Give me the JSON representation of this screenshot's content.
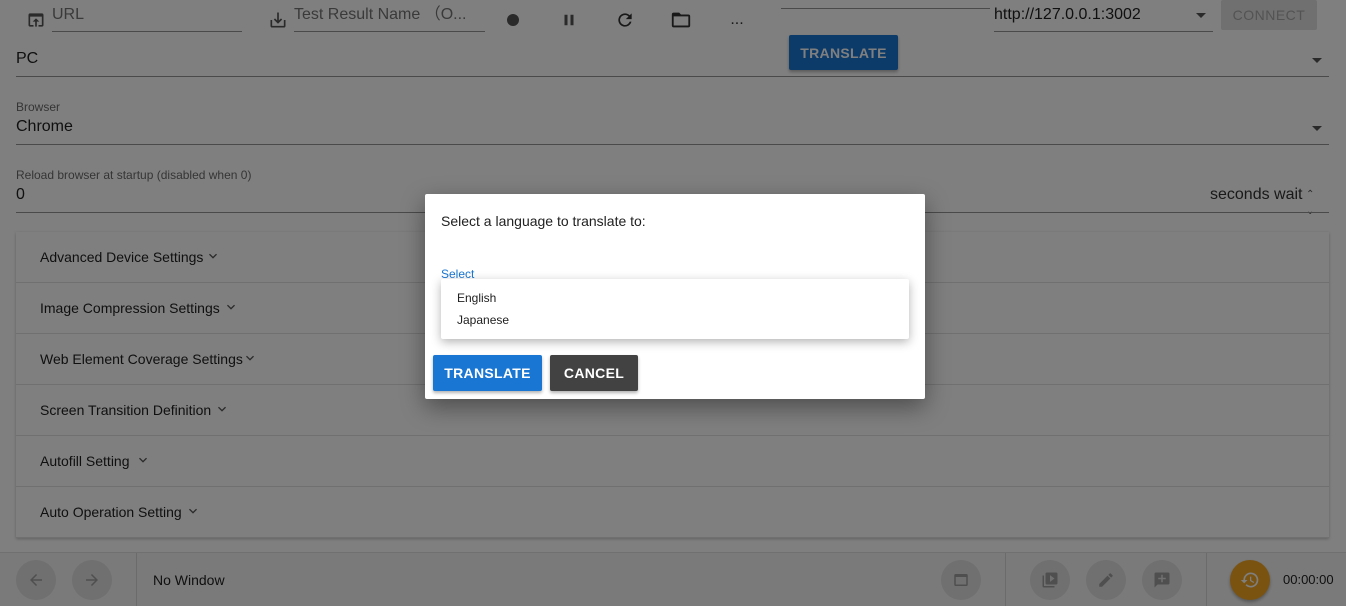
{
  "toolbar": {
    "url_placeholder": "URL",
    "test_result_placeholder": "Test Result Name （O...",
    "server_url": "http://127.0.0.1:3002",
    "connect_label": "CONNECT",
    "translate_label": "TRANSLATE",
    "more_label": "..."
  },
  "settings": {
    "platform_value": "PC",
    "browser_label": "Browser",
    "browser_value": "Chrome",
    "reload_label": "Reload browser at startup (disabled when 0)",
    "reload_value": "0",
    "reload_suffix": "seconds wait"
  },
  "panels": [
    {
      "label": "Advanced Device Settings"
    },
    {
      "label": "Image Compression Settings"
    },
    {
      "label": "Web Element Coverage Settings"
    },
    {
      "label": "Screen Transition Definition"
    },
    {
      "label": "Autofill Setting"
    },
    {
      "label": "Auto Operation Setting"
    }
  ],
  "bottombar": {
    "window_label": "No Window",
    "timer": "00:00:00"
  },
  "dialog": {
    "title": "Select a language to translate to:",
    "select_label": "Select",
    "options": [
      "English",
      "Japanese"
    ],
    "translate_label": "TRANSLATE",
    "cancel_label": "CANCEL"
  }
}
